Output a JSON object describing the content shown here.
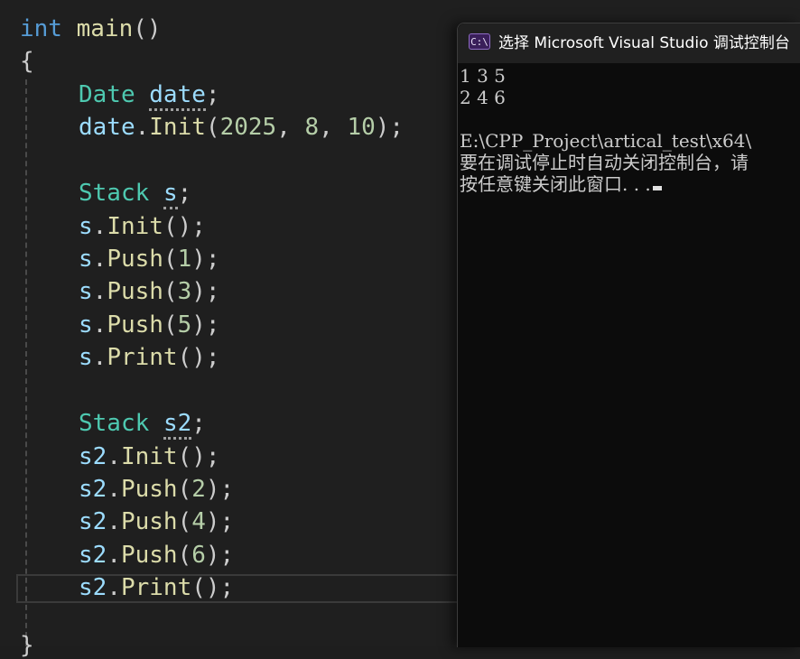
{
  "editor": {
    "lines": {
      "l0": {
        "kw": "int",
        "fn": "main",
        "pun": "()"
      },
      "l1": {
        "pun": "{"
      },
      "l2": {
        "ty": "Date",
        "var": "date",
        "pun": ";"
      },
      "l3": {
        "var": "date",
        "dot": ".",
        "fn": "Init",
        "open": "(",
        "n1": "2025",
        "c1": ", ",
        "n2": "8",
        "c2": ", ",
        "n3": "10",
        "close": ");"
      },
      "l5": {
        "ty": "Stack",
        "var": "s",
        "pun": ";"
      },
      "l6": {
        "var": "s",
        "dot": ".",
        "fn": "Init",
        "pun": "();"
      },
      "l7": {
        "var": "s",
        "dot": ".",
        "fn": "Push",
        "open": "(",
        "num": "1",
        "close": ");"
      },
      "l8": {
        "var": "s",
        "dot": ".",
        "fn": "Push",
        "open": "(",
        "num": "3",
        "close": ");"
      },
      "l9": {
        "var": "s",
        "dot": ".",
        "fn": "Push",
        "open": "(",
        "num": "5",
        "close": ");"
      },
      "l10": {
        "var": "s",
        "dot": ".",
        "fn": "Print",
        "pun": "();"
      },
      "l12": {
        "ty": "Stack",
        "var": "s2",
        "pun": ";"
      },
      "l13": {
        "var": "s2",
        "dot": ".",
        "fn": "Init",
        "pun": "();"
      },
      "l14": {
        "var": "s2",
        "dot": ".",
        "fn": "Push",
        "open": "(",
        "num": "2",
        "close": ");"
      },
      "l15": {
        "var": "s2",
        "dot": ".",
        "fn": "Push",
        "open": "(",
        "num": "4",
        "close": ");"
      },
      "l16": {
        "var": "s2",
        "dot": ".",
        "fn": "Push",
        "open": "(",
        "num": "6",
        "close": ");"
      },
      "l17": {
        "var": "s2",
        "dot": ".",
        "fn": "Print",
        "pun": "();"
      },
      "l18": {
        "pun": "}"
      }
    }
  },
  "console": {
    "icon_text": "C:\\",
    "title": "选择 Microsoft Visual Studio 调试控制台",
    "output": [
      "1 3 5",
      "2 4 6",
      "",
      "E:\\CPP_Project\\artical_test\\x64\\",
      "要在调试停止时自动关闭控制台，请",
      "按任意键关闭此窗口. . ."
    ]
  },
  "colors": {
    "editor_background": "#1f1f1f",
    "keyword": "#569cd6",
    "function": "#dcdcaa",
    "type": "#4ec9b0",
    "variable": "#9cdcfe",
    "number": "#b5cea8",
    "console_background": "#0c0c0c",
    "console_titlebar": "#202020"
  },
  "icons": [
    "console-app-icon",
    "text-cursor"
  ]
}
